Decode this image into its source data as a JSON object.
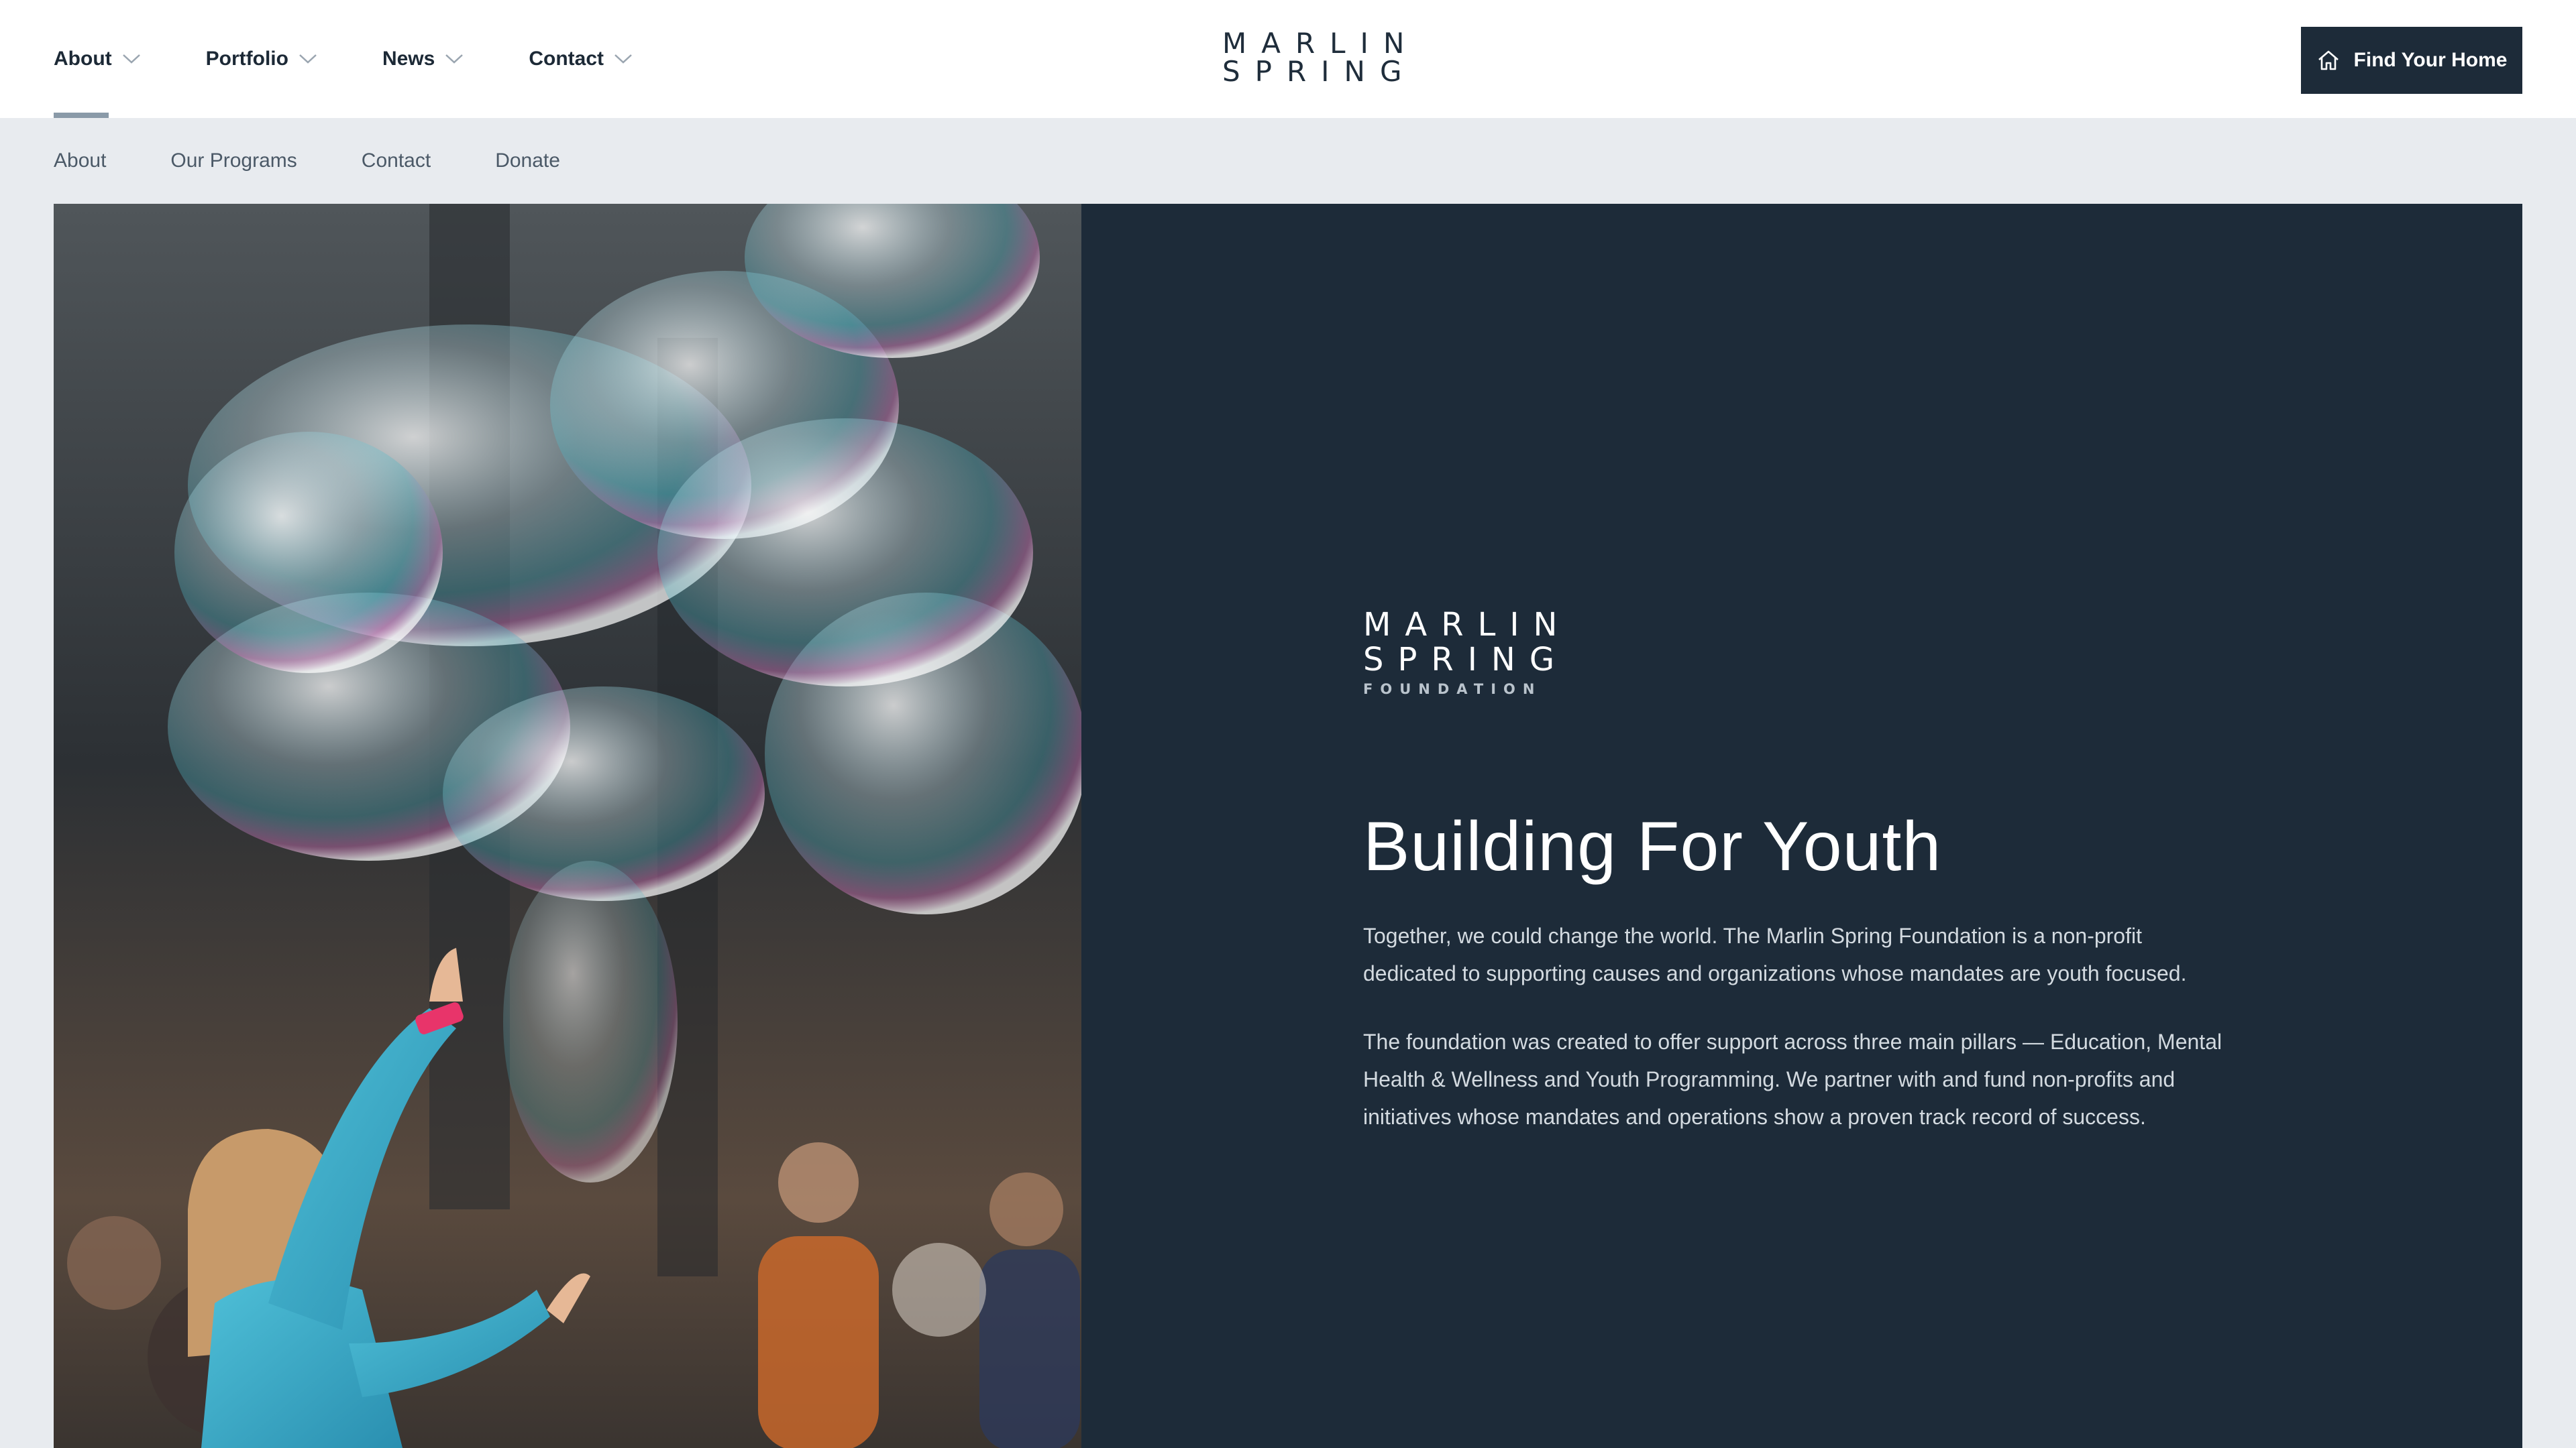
{
  "header": {
    "nav": [
      {
        "label": "About",
        "active": true
      },
      {
        "label": "Portfolio",
        "active": false
      },
      {
        "label": "News",
        "active": false
      },
      {
        "label": "Contact",
        "active": false
      }
    ],
    "brand": {
      "line1": "MARLIN",
      "line2": "SPRING"
    },
    "cta": {
      "label": "Find Your Home",
      "icon": "home-icon"
    }
  },
  "subnav": {
    "items": [
      "About",
      "Our Programs",
      "Contact",
      "Donate"
    ]
  },
  "hero": {
    "photo": {
      "icon": "child-bubbles-photo"
    },
    "logo": {
      "line1": "MARLIN",
      "line2": "SPRING",
      "line3": "FOUNDATION"
    },
    "title": "Building For Youth",
    "paragraphs": [
      "Together, we could change the world. The Marlin Spring Foundation is a non-profit dedicated to supporting causes and organizations whose mandates are youth focused.",
      "The foundation was created to offer support across three main pillars — Education, Mental Health & Wellness and Youth Programming. We partner with and fund non-profits and initiatives whose mandates and operations show a proven track record of success."
    ]
  },
  "colors": {
    "navy": "#1d2b39",
    "subnav_bg": "#e8ebef",
    "active_underline": "#8a9aa8",
    "body_text": "#d3dae0"
  }
}
